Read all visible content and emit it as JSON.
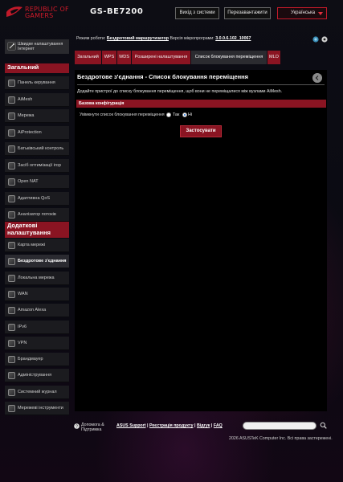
{
  "header": {
    "brand_line1": "REPUBLIC OF",
    "brand_line2": "GAMERS",
    "model": "GS-BE7200",
    "logout_label": "Вихід з системи",
    "reboot_label": "Перезавантажити",
    "language": "Українська"
  },
  "status": {
    "mode_label": "Режим роботи:",
    "mode_value": "Бездротовий маршрутизатор",
    "fw_label": "Версія мікропрограми:",
    "fw_value": "3.0.0.6.102_10067"
  },
  "sidebar": {
    "qis_label": "Швидке налаштування Інтернет",
    "general_title": "Загальний",
    "general_items": [
      {
        "label": "Панель керування",
        "icon": "dashboard-icon"
      },
      {
        "label": "AiMesh",
        "icon": "aimesh-icon"
      },
      {
        "label": "Мережа",
        "icon": "network-icon"
      },
      {
        "label": "AiProtection",
        "icon": "shield-icon"
      },
      {
        "label": "Батьківський контроль",
        "icon": "parental-icon"
      },
      {
        "label": "Засіб оптимізації ігор",
        "icon": "gamepad-icon"
      },
      {
        "label": "Open NAT",
        "icon": "nat-icon"
      },
      {
        "label": "Адаптивна QoS",
        "icon": "qos-icon"
      },
      {
        "label": "Аналізатор потоків",
        "icon": "analyzer-icon"
      }
    ],
    "advanced_title": "Додаткові налаштування",
    "advanced_items": [
      {
        "label": "Карта мережі",
        "icon": "map-icon"
      },
      {
        "label": "Бездротове з'єднання",
        "icon": "wifi-icon"
      },
      {
        "label": "Локальна мережа",
        "icon": "home-icon"
      },
      {
        "label": "WAN",
        "icon": "globe-icon"
      },
      {
        "label": "Amazon Alexa",
        "icon": "alexa-icon"
      },
      {
        "label": "IPv6",
        "icon": "ipv6-icon"
      },
      {
        "label": "VPN",
        "icon": "vpn-icon"
      },
      {
        "label": "Брандмауер",
        "icon": "firewall-icon"
      },
      {
        "label": "Адміністрування",
        "icon": "admin-icon"
      },
      {
        "label": "Системний журнал",
        "icon": "log-icon"
      },
      {
        "label": "Мережеві інструменти",
        "icon": "tools-icon"
      }
    ],
    "active": "Бездротове з'єднання"
  },
  "tabs": [
    {
      "label": "Загальний"
    },
    {
      "label": "WPS"
    },
    {
      "label": "WDS"
    },
    {
      "label": "Розширені налаштування"
    },
    {
      "label": "Список блокування переміщення"
    },
    {
      "label": "MLO"
    }
  ],
  "panel": {
    "title": "Бездротове з'єднання - Список блокування переміщення",
    "description": "Додайте пристрої до списку блокування переміщення, щоб вони не переміщалися між вузлами AiMesh.",
    "config_header": "Базова конфігурація",
    "enable_label": "Увімкнути список блокування переміщення",
    "option_yes": "Так",
    "option_no": "Ні",
    "selected": "Ні",
    "apply_label": "Застосувати"
  },
  "footer": {
    "help_label": "Допомога & Підтримка",
    "links": [
      "ASUS Support",
      "Реєстрація продукту",
      "Відгук",
      "FAQ"
    ],
    "copyright": "2026 ASUSTeK Computer Inc. Всі права застережені."
  },
  "colors": {
    "accent": "#8a1422",
    "brand": "#d21a2a",
    "background": "#0a0a12"
  }
}
